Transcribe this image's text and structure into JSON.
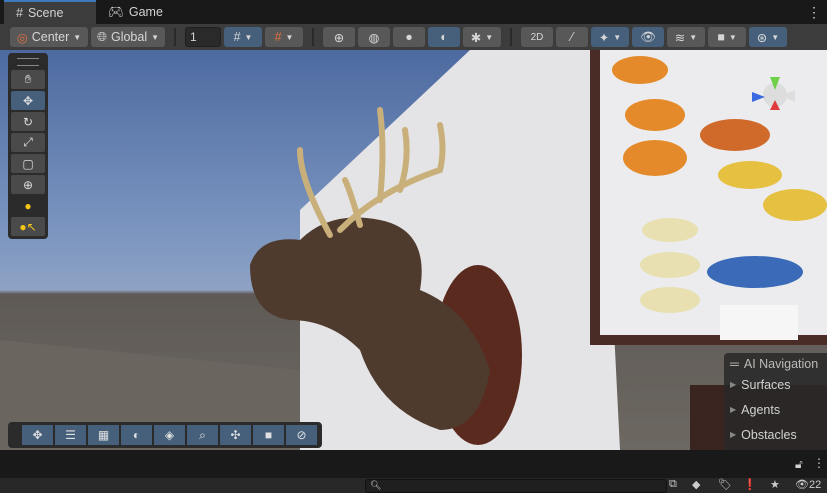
{
  "tabs": [
    {
      "label": "Scene",
      "icon": "grid-icon"
    },
    {
      "label": "Game",
      "icon": "gamepad-icon"
    }
  ],
  "toolbar": {
    "pivot": "Center",
    "space": "Global",
    "grid_increment": "1"
  },
  "ai_navigation": {
    "title": "AI Navigation",
    "items": [
      "Surfaces",
      "Agents",
      "Obstacles"
    ]
  },
  "status": {
    "visible_count": "22"
  },
  "colors": {
    "accent": "#46607c",
    "tab_highlight": "#3a79bb"
  }
}
